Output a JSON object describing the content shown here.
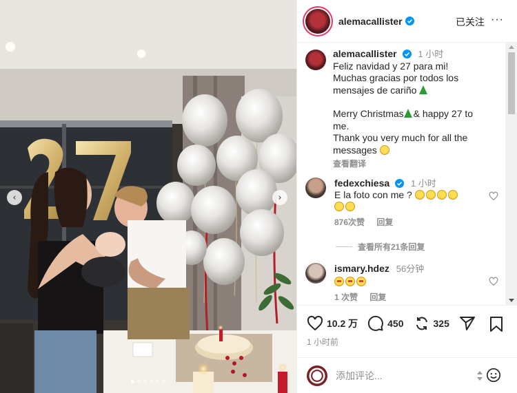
{
  "photo": {
    "balloon_number": "27",
    "nav_prev": "‹",
    "nav_next": "›",
    "slide_count": 6,
    "active_slide": 1
  },
  "header": {
    "username": "alemacallister",
    "follow_status": "已关注",
    "more": "···"
  },
  "caption": {
    "username": "alemacallister",
    "time": "1 小时",
    "lines_es": [
      "Feliz navidad y 27 para mi!",
      "Muchas gracias por todos los",
      "mensajes de cariño"
    ],
    "lines_en": [
      "Merry Christmas",
      "& happy 27 to",
      "me.",
      "Thank you very much for all the",
      "messages"
    ],
    "translate_label": "查看翻译"
  },
  "comments": [
    {
      "username": "fedexchiesa",
      "time": "1 小时",
      "text": "E la foto con me ?",
      "likes": "876次赞",
      "reply": "回复"
    },
    {
      "username": "ismary.hdez",
      "time": "56分钟",
      "text": "",
      "likes": "1 次赞",
      "reply": "回复"
    }
  ],
  "view_replies": "查看所有21条回复",
  "actions": {
    "likes": "10.2 万",
    "comments": "450",
    "reposts": "325",
    "posted": "1 小时前"
  },
  "add_comment": {
    "placeholder": "添加评论..."
  },
  "colors": {
    "verified": "#0095f6",
    "muted": "#8e8e8e",
    "text": "#262626",
    "story_ring": "#e23b6a"
  }
}
